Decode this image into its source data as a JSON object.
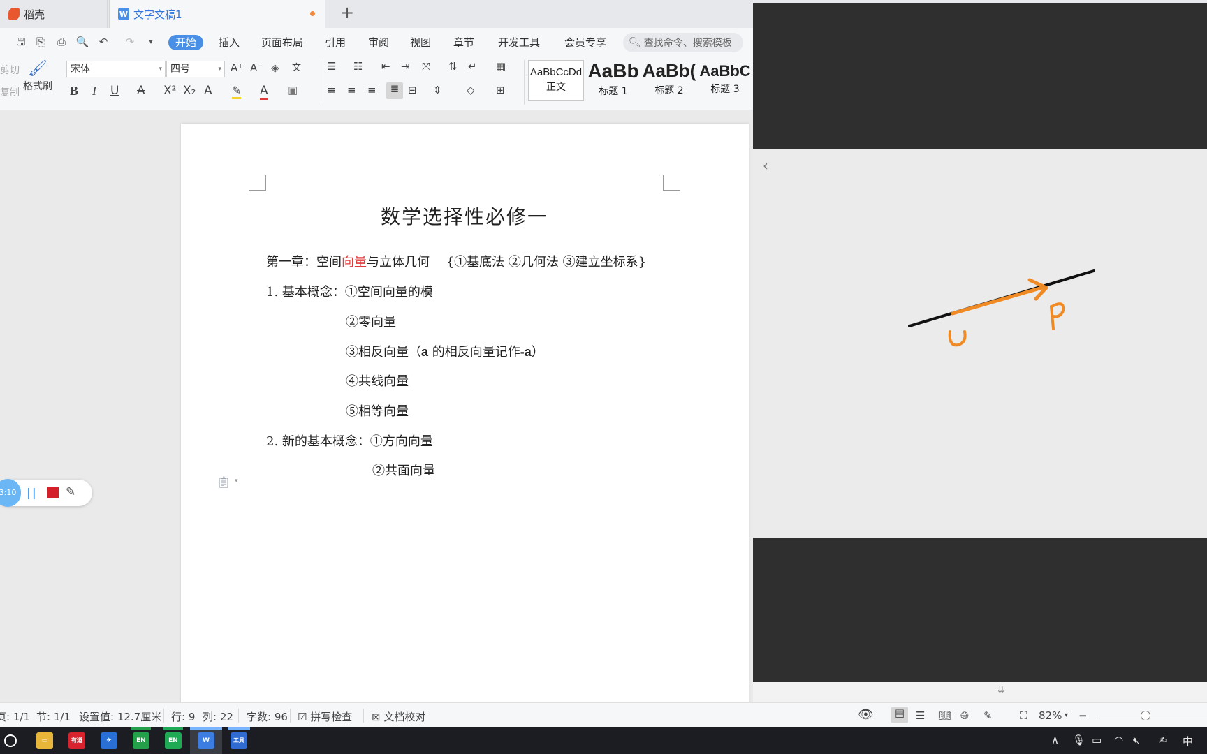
{
  "tabs": {
    "daoke": "稻壳",
    "document": "文字文稿1",
    "add": "+"
  },
  "menu": {
    "items": [
      "开始",
      "插入",
      "页面布局",
      "引用",
      "审阅",
      "视图",
      "章节",
      "开发工具",
      "会员专享"
    ],
    "search_placeholder": "查找命令、搜索模板"
  },
  "ribbon": {
    "cut": "剪切",
    "copy": "复制",
    "format_painter": "格式刷",
    "font_name": "宋体",
    "font_size": "四号",
    "styles": [
      {
        "sample": "AaBbCcDd",
        "name": "正文"
      },
      {
        "sample": "AaBb",
        "name": "标题 1"
      },
      {
        "sample": "AaBb(",
        "name": "标题 2"
      },
      {
        "sample": "AaBbC",
        "name": "标题 3"
      }
    ]
  },
  "document": {
    "title": "数学选择性必修一",
    "chapter_prefix": "第一章：空间",
    "chapter_highlight": "向量",
    "chapter_suffix": "与立体几何",
    "chapter_methods": "{①基底法  ②几何法  ③建立坐标系}",
    "concept1_label": "1. 基本概念：",
    "concept1_items": [
      "①空间向量的模",
      "②零向量",
      "③相反向量（",
      "④共线向量",
      "⑤相等向量"
    ],
    "opposite_bold_a": "a",
    "opposite_mid": " 的相反向量记作",
    "opposite_neg_a": "-a",
    "opposite_close": "）",
    "concept2_label": "2. 新的基本概念：",
    "concept2_items": [
      "①方向向量",
      "②共面向量"
    ]
  },
  "recording": {
    "time": "3:10"
  },
  "status": {
    "page": "页: 1/1",
    "section": "节: 1/1",
    "setting": "设置值: 12.7厘米",
    "row": "行: 9",
    "col": "列: 22",
    "words": "字数: 96",
    "spell": "拼写检查",
    "proof": "文档校对",
    "zoom": "82%"
  },
  "taskbar": {
    "apps": [
      "有道",
      "EN",
      "EN",
      "W",
      "工具"
    ],
    "ime": "中"
  },
  "viewer": {
    "label_o": "O",
    "label_p": "P"
  },
  "colors": {
    "accent": "#4a8fe6",
    "highlight_red": "#e03b3b",
    "ink_orange": "#f08a24"
  }
}
